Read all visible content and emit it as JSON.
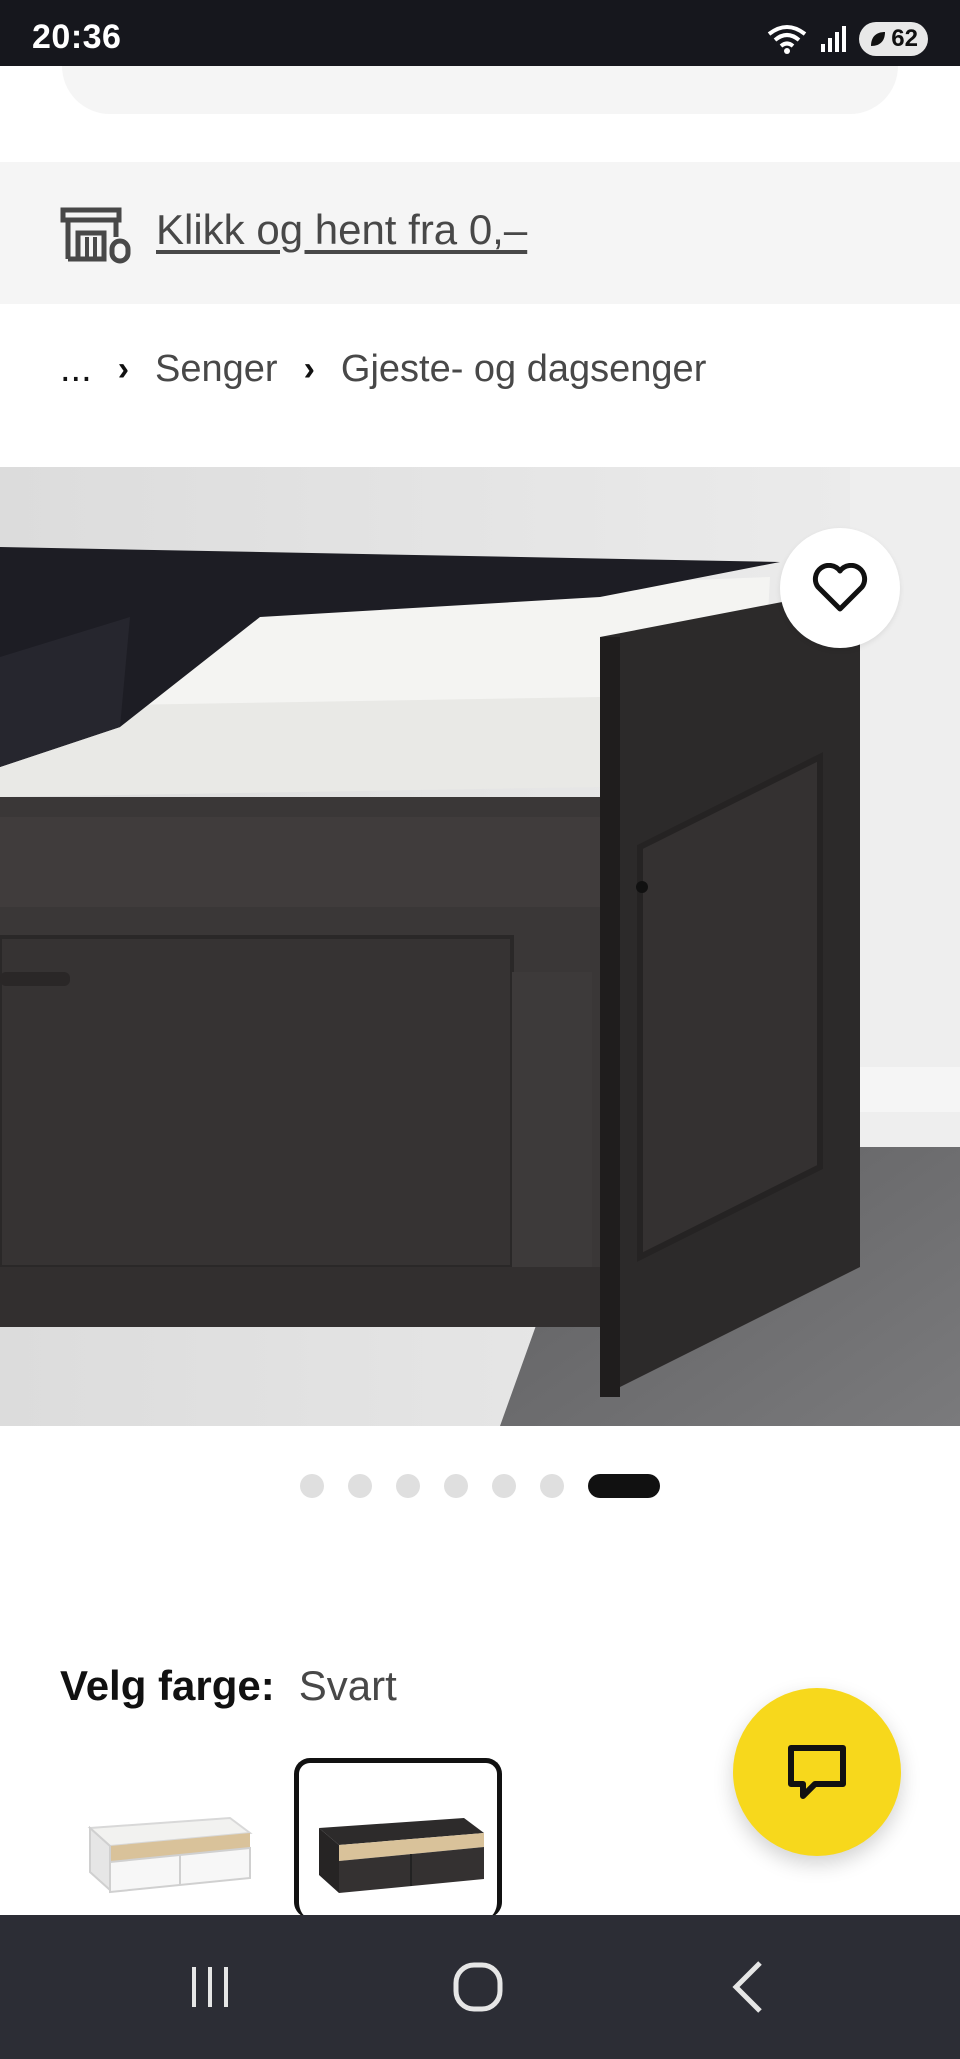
{
  "status_bar": {
    "time": "20:36",
    "battery": "62",
    "icons": [
      "wifi-icon",
      "signal-icon",
      "battery-icon"
    ]
  },
  "click_collect": {
    "icon": "store-icon",
    "link_text": "Klikk og hent fra 0,–"
  },
  "breadcrumb": {
    "items": [
      "...",
      "Senger",
      "Gjeste- og dagsenger"
    ]
  },
  "product_gallery": {
    "image": "black-daybed-photo",
    "total_images": 7,
    "active_index": 7
  },
  "color_selector": {
    "label": "Velg farge:",
    "value": "Svart",
    "swatches": [
      {
        "color": "white",
        "selected": false
      },
      {
        "color": "black",
        "selected": true
      }
    ]
  },
  "colors": {
    "status_bg": "#16171d",
    "nav_bg": "#2c2d35",
    "accent_yellow": "#f7d81c",
    "panel_gray": "#f5f5f5",
    "text_dark": "#111111",
    "text_muted": "#484848"
  },
  "nav_bar": {
    "buttons": [
      "recent-apps-icon",
      "home-icon",
      "back-icon"
    ]
  }
}
